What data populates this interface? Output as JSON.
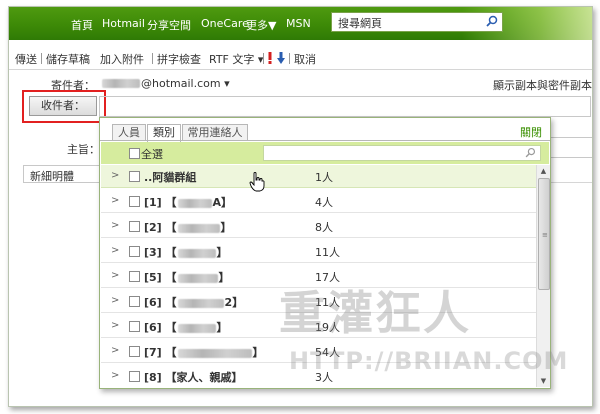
{
  "nav": {
    "items": [
      "首頁",
      "Hotmail",
      "分享空間",
      "OneCare",
      "更多▼",
      "MSN"
    ],
    "search_placeholder": "搜尋網頁"
  },
  "toolbar": {
    "items": [
      "傳送",
      "儲存草稿",
      "加入附件",
      "拼字檢查",
      "RTF 文字 ▾",
      "取消"
    ]
  },
  "compose": {
    "from_label": "寄件者：",
    "from_address": "@hotmail.com ▾",
    "show_cc_bcc": "顯示副本與密件副本",
    "to_button": "收件者：",
    "subject_label": "主旨：",
    "format_label": "新細明體"
  },
  "popup": {
    "tabs": [
      "人員",
      "類別",
      "常用連絡人"
    ],
    "active_tab": "類別",
    "close_label": "關閉",
    "select_all_label": "全選",
    "groups": [
      {
        "label": "..阿貓群組",
        "count": "1人"
      },
      {
        "label": "[1] 【",
        "label_end": "A】",
        "count": "4人"
      },
      {
        "label": "[2] 【",
        "label_end": "】",
        "count": "8人"
      },
      {
        "label": "[3] 【",
        "label_end": "】",
        "count": "11人"
      },
      {
        "label": "[5] 【",
        "label_end": "】",
        "count": "17人"
      },
      {
        "label": "[6] 【",
        "label_end": "2】",
        "count": "11人"
      },
      {
        "label": "[6] 【",
        "label_end": "】",
        "count": "19人"
      },
      {
        "label": "[7] 【",
        "label_end": "】",
        "count": "54人"
      },
      {
        "label": "[8] 【家人、親戚】",
        "count": "3人"
      }
    ]
  },
  "watermark": {
    "title": "重灌狂人",
    "url": "HTTP://BRIIAN.COM"
  },
  "colors": {
    "accent_green": "#3d8a07",
    "highlight_red": "#e22020",
    "selectall_bg": "#d6ec9e"
  }
}
